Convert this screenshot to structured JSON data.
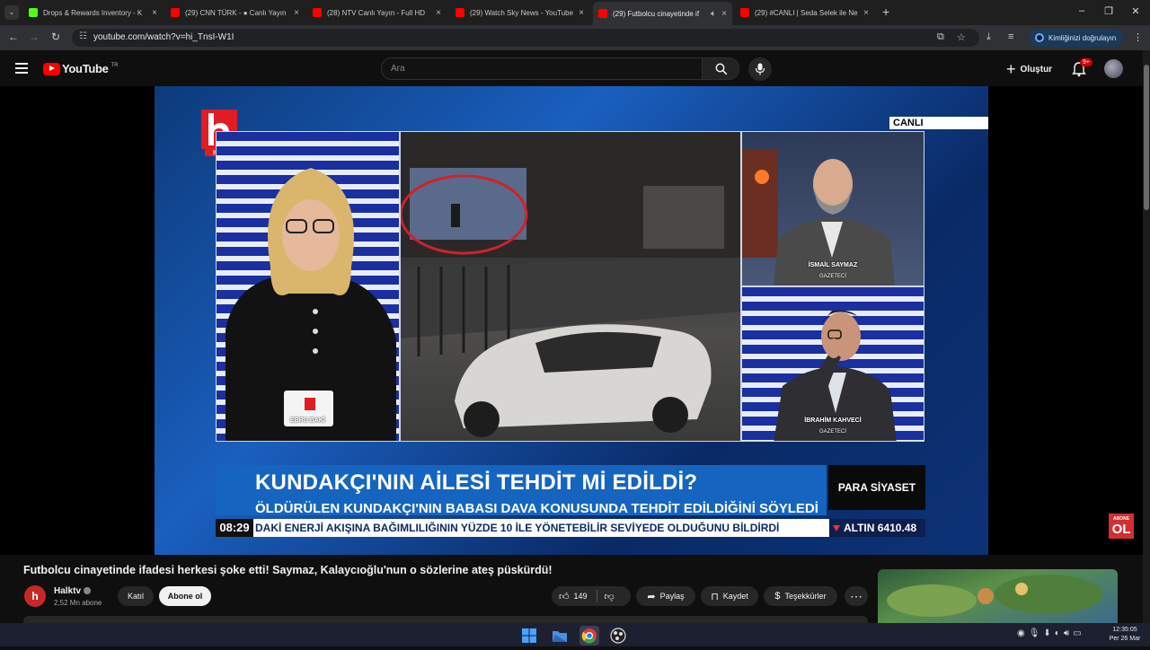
{
  "browser": {
    "tabs": [
      {
        "title": "Drops & Rewards Inventory - K",
        "favicon_color": "#53fc18",
        "active": false
      },
      {
        "title": "(29) CNN TÜRK - ● Canlı Yayın",
        "favicon_color": "#ff0000",
        "active": false
      },
      {
        "title": "(28) NTV Canlı Yayın - Full HD",
        "favicon_color": "#ff0000",
        "active": false
      },
      {
        "title": "(29) Watch Sky News - YouTube",
        "favicon_color": "#ff0000",
        "active": false
      },
      {
        "title": "(29) Futbolcu cinayetinde if",
        "favicon_color": "#ff0000",
        "active": true
      },
      {
        "title": "(29) #CANLI | Seda Selek ile Ne",
        "favicon_color": "#ff0000",
        "active": false
      }
    ],
    "tab_close_glyph": "×",
    "new_tab_glyph": "+",
    "url": "youtube.com/watch?v=hi_TnsI-W1I",
    "verify_label": "Kimliğinizi doğrulayın"
  },
  "youtube": {
    "logo_text": "YouTube",
    "region": "TR",
    "search_placeholder": "Ara",
    "create_label": "Oluştur",
    "notifications_badge": "9+"
  },
  "video": {
    "live_badge": "CANLI",
    "channel_logo_text": "halk",
    "host_name": "EBRU BAKİ",
    "guest1_name": "İSMAİL SAYMAZ",
    "guest1_role": "GAZETECİ",
    "guest2_name": "İBRAHİM KAHVECİ",
    "guest2_role": "GAZETECİ",
    "headline": "KUNDAKÇI'NIN AİLESİ TEHDİT Mİ EDİLDİ?",
    "subline": "ÖLDÜRÜLEN KUNDAKÇI'NIN BABASI DAVA KONUSUNDA TEHDİT EDİLDİĞİNİ SÖYLEDİ",
    "program_name": "PARA SİYASET",
    "clock": "08:29",
    "ticker": "DAKİ ENERJİ AKIŞINA BAĞIMLILIĞININ YÜZDE 10 İLE YÖNETEBİLİR SEVİYEDE OLDUĞUNU BİLDİRDİ",
    "gold_label": "ALTIN 6410.48",
    "subscribe_overlay_top": "ABONE",
    "subscribe_overlay_main": "OL"
  },
  "watch": {
    "title": "Futbolcu cinayetinde ifadesi herkesi şoke etti! Saymaz, Kalaycıoğlu'nun o sözlerine ateş püskürdü!",
    "channel_name": "Halktv",
    "channel_avatar_text": "h",
    "subscribers": "2,52 Mn abone",
    "join_label": "Katıl",
    "subscribe_label": "Abone ol",
    "like_count": "149",
    "share_label": "Paylaş",
    "save_label": "Kaydet",
    "thanks_label": "Teşekkürler",
    "more_glyph": "⋯"
  },
  "taskbar": {
    "time": "12:35:05",
    "date": "Per 26 Mar"
  }
}
